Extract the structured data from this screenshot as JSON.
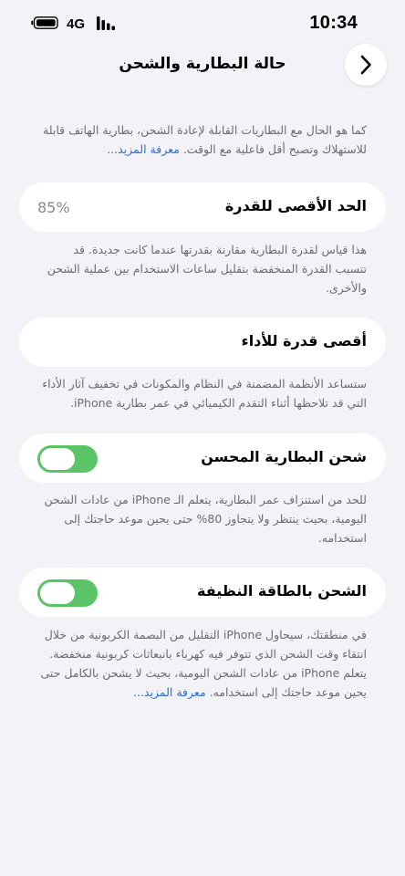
{
  "status_bar": {
    "time": "10:34",
    "network": "4G",
    "battery_icon": "battery-icon",
    "signal_icon": "signal-bars-icon"
  },
  "nav": {
    "title": "حالة البطارية والشحن",
    "back_icon": "chevron-right-icon"
  },
  "intro": {
    "text": "كما هو الحال مع البطاريات القابلة لإعادة الشحن، بطارية الهاتف قابلة للاستهلاك وتصبح أقل فاعلية مع الوقت. ",
    "link": "معرفة المزيد..."
  },
  "max_capacity": {
    "label": "الحد الأقصى للقدرة",
    "value": "85%",
    "footnote": "هذا قياس لقدرة البطارية مقارنة بقدرتها عندما كانت جديدة. قد تتسبب القدرة المنخفضة بتقليل ساعات الاستخدام بين عملية الشحن والأخرى."
  },
  "peak_performance": {
    "label": "أقصى قدرة للأداء",
    "footnote": "ستساعد الأنظمة المضمنة في النظام والمكونات في تخفيف آثار الأداء التي قد تلاحظها أثناء التقدم الكيميائي في عمر بطارية iPhone."
  },
  "optimized_charging": {
    "label": "شحن البطارية المحسن",
    "enabled": true,
    "footnote": "للحد من استنزاف عمر البطارية، يتعلم الـ iPhone من عادات الشحن اليومية، بحيث ينتظر ولا يتجاوز 80% حتى يحين موعد حاجتك إلى استخدامه."
  },
  "clean_energy": {
    "label": "الشحن بالطاقة النظيفة",
    "enabled": true,
    "footnote": "في منطقتك، سيحاول iPhone التقليل من البصمة الكربونية من خلال انتقاء وقت الشحن الذي تتوفر فيه كهرباء بانبعاثات كربونية منخفضة. يتعلم iPhone من عادات الشحن اليومية، بحيث لا يشحن بالكامل حتى يحين موعد حاجتك إلى استخدامه. ",
    "link": "معرفة المزيد..."
  },
  "colors": {
    "background": "#f2f2f7",
    "card": "#ffffff",
    "toggle_on": "#5ac466",
    "link": "#2a6fd6",
    "footnote": "#6b6b70"
  }
}
